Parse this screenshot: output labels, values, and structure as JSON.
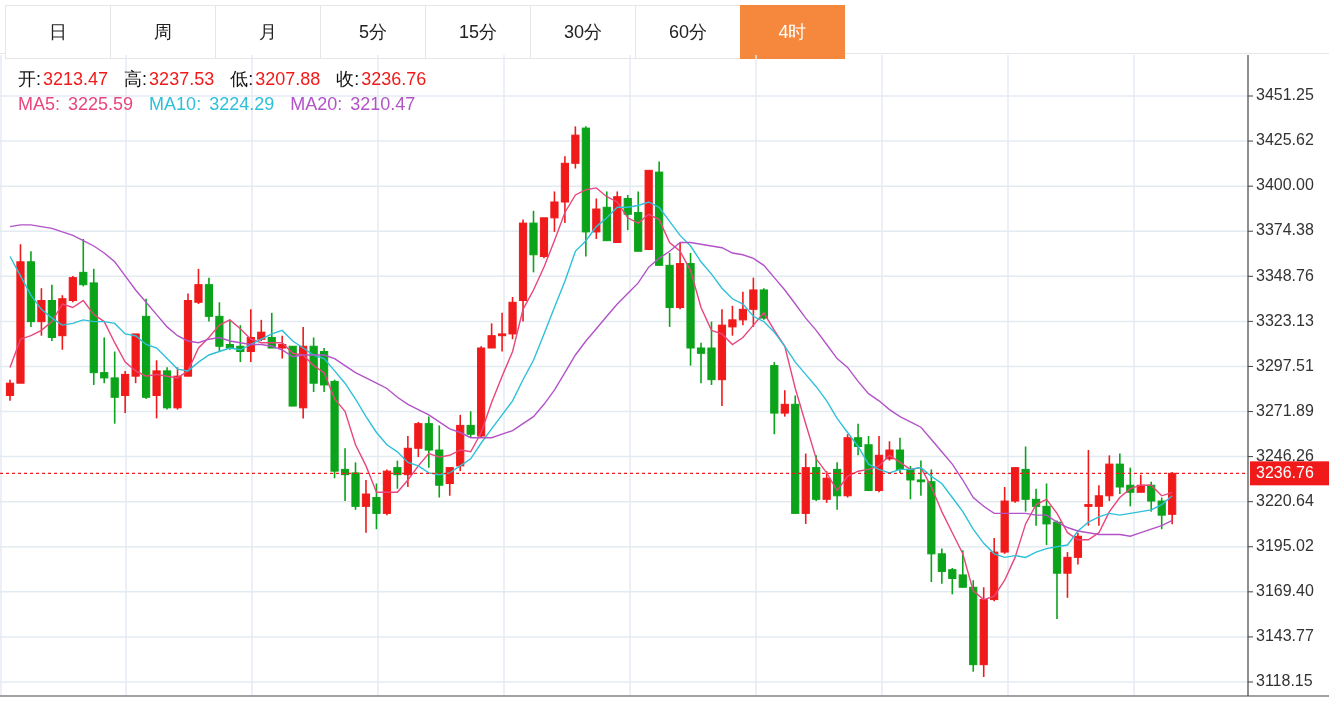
{
  "tabs": [
    {
      "label": "日",
      "selected": false
    },
    {
      "label": "周",
      "selected": false
    },
    {
      "label": "月",
      "selected": false
    },
    {
      "label": "5分",
      "selected": false
    },
    {
      "label": "15分",
      "selected": false
    },
    {
      "label": "30分",
      "selected": false
    },
    {
      "label": "60分",
      "selected": false
    },
    {
      "label": "4时",
      "selected": true
    }
  ],
  "ohlc_legend": [
    {
      "label": "开:",
      "value": "3213.47"
    },
    {
      "label": "高:",
      "value": "3237.53"
    },
    {
      "label": "低:",
      "value": "3207.88"
    },
    {
      "label": "收:",
      "value": "3236.76"
    }
  ],
  "ma_legend": [
    {
      "separator": ":",
      "value": "3225.59"
    },
    {
      "separator": ":",
      "value": "3224.29"
    },
    {
      "separator": ":",
      "value": "3210.47"
    }
  ],
  "chart_data": {
    "type": "candlestick",
    "grid": true,
    "ylim": [
      3118.15,
      3451.25
    ],
    "yticks": [
      {
        "value": 3451.25,
        "label": "3451.25"
      },
      {
        "value": 3425.62,
        "label": "3425.62"
      },
      {
        "value": 3400,
        "label": "3400.00"
      },
      {
        "value": 3374.38,
        "label": "3374.38"
      },
      {
        "value": 3348.76,
        "label": "3348.76"
      },
      {
        "value": 3323.13,
        "label": "3323.13"
      },
      {
        "value": 3297.51,
        "label": "3297.51"
      },
      {
        "value": 3271.89,
        "label": "3271.89"
      },
      {
        "value": 3246.26,
        "label": "3246.26"
      },
      {
        "value": 3220.64,
        "label": "3220.64"
      },
      {
        "value": 3195.02,
        "label": "3195.02"
      },
      {
        "value": 3169.4,
        "label": "3169.40"
      },
      {
        "value": 3143.77,
        "label": "3143.77"
      },
      {
        "value": 3118.15,
        "label": "3118.15"
      }
    ],
    "ref_lines": [
      {
        "axis": "y",
        "value": 3236.76,
        "label": "3236.76",
        "color": "#f01a1a"
      }
    ],
    "series": [
      {
        "name": "MA5",
        "type": "line",
        "color": "#e8467c",
        "values": [
          3297,
          3313,
          3315,
          3318,
          3323,
          3333,
          3331,
          3335,
          3327,
          3323,
          3311,
          3300,
          3295,
          3292,
          3293,
          3292,
          3291,
          3295,
          3308,
          3314,
          3321,
          3324,
          3319,
          3313,
          3311,
          3311,
          3311,
          3305,
          3304,
          3298,
          3294,
          3279,
          3272,
          3253,
          3241,
          3226,
          3226,
          3226,
          3233,
          3241,
          3248,
          3246,
          3247,
          3250,
          3249,
          3260,
          3277,
          3292,
          3306,
          3330,
          3341,
          3354,
          3369,
          3385,
          3395,
          3398,
          3399,
          3394,
          3391,
          3382,
          3379,
          3384,
          3381,
          3368,
          3363,
          3352,
          3331,
          3318,
          3316,
          3310,
          3314,
          3321,
          3328,
          3318,
          3309,
          3285,
          3265,
          3245,
          3237,
          3227,
          3235,
          3238,
          3239,
          3241,
          3247,
          3243,
          3239,
          3240,
          3229,
          3215,
          3203,
          3191,
          3170,
          3165,
          3167,
          3176,
          3189,
          3208,
          3219,
          3222,
          3214,
          3203,
          3199,
          3199,
          3203,
          3215,
          3223,
          3228,
          3230,
          3230,
          3224,
          3226
        ]
      },
      {
        "name": "MA10",
        "type": "line",
        "color": "#2ec0d9",
        "values": [
          3360,
          3349,
          3338,
          3330,
          3325,
          3321,
          3322,
          3324,
          3323,
          3323,
          3322,
          3316,
          3315,
          3310,
          3308,
          3302,
          3296,
          3295,
          3300,
          3304,
          3306,
          3308,
          3307,
          3310,
          3313,
          3316,
          3318,
          3312,
          3308,
          3304,
          3302,
          3295,
          3288,
          3279,
          3269,
          3260,
          3253,
          3249,
          3243,
          3241,
          3237,
          3236,
          3237,
          3241,
          3245,
          3254,
          3262,
          3270,
          3278,
          3290,
          3301,
          3316,
          3331,
          3346,
          3363,
          3369,
          3377,
          3382,
          3388,
          3388,
          3389,
          3391,
          3388,
          3380,
          3372,
          3366,
          3357,
          3350,
          3342,
          3336,
          3333,
          3326,
          3323,
          3317,
          3309,
          3300,
          3293,
          3286,
          3278,
          3268,
          3260,
          3252,
          3242,
          3239,
          3237,
          3239,
          3239,
          3240,
          3235,
          3231,
          3223,
          3215,
          3205,
          3197,
          3191,
          3189,
          3190,
          3189,
          3192,
          3194,
          3195,
          3196,
          3204,
          3209,
          3212,
          3214,
          3213,
          3214,
          3215,
          3216,
          3219,
          3224
        ]
      },
      {
        "name": "MA20",
        "type": "line",
        "color": "#b253c8",
        "values": [
          3377,
          3378,
          3378,
          3377,
          3376,
          3374,
          3372,
          3369,
          3366,
          3362,
          3357,
          3349,
          3341,
          3334,
          3327,
          3320,
          3315,
          3312,
          3311,
          3313,
          3314,
          3312,
          3311,
          3310,
          3310,
          3309,
          3307,
          3303,
          3304,
          3304,
          3304,
          3302,
          3298,
          3294,
          3291,
          3288,
          3285,
          3280,
          3276,
          3273,
          3270,
          3266,
          3262,
          3260,
          3257,
          3257,
          3257,
          3259,
          3261,
          3265,
          3269,
          3276,
          3284,
          3294,
          3304,
          3312,
          3319,
          3326,
          3333,
          3339,
          3345,
          3354,
          3359,
          3363,
          3368,
          3368,
          3367,
          3366,
          3365,
          3362,
          3361,
          3359,
          3355,
          3348,
          3341,
          3333,
          3325,
          3318,
          3310,
          3302,
          3297,
          3289,
          3282,
          3278,
          3273,
          3269,
          3266,
          3263,
          3256,
          3249,
          3242,
          3233,
          3223,
          3218,
          3214,
          3214,
          3214,
          3214,
          3213,
          3213,
          3209,
          3206,
          3204,
          3203,
          3202,
          3202,
          3202,
          3201,
          3203,
          3205,
          3207,
          3210
        ]
      }
    ],
    "ohlc": [
      [
        3281,
        3290,
        3278,
        3288
      ],
      [
        3288,
        3367,
        3288,
        3357
      ],
      [
        3357,
        3363,
        3320,
        3323
      ],
      [
        3323,
        3342,
        3315,
        3335
      ],
      [
        3335,
        3344,
        3312,
        3314
      ],
      [
        3315,
        3338,
        3307,
        3336
      ],
      [
        3335,
        3349,
        3334,
        3348
      ],
      [
        3351,
        3370,
        3343,
        3344
      ],
      [
        3345,
        3353,
        3287,
        3294
      ],
      [
        3294,
        3314,
        3288,
        3291
      ],
      [
        3291,
        3306,
        3265,
        3280
      ],
      [
        3281,
        3295,
        3271,
        3293
      ],
      [
        3292,
        3316,
        3288,
        3316
      ],
      [
        3326,
        3336,
        3279,
        3280
      ],
      [
        3281,
        3301,
        3268,
        3295
      ],
      [
        3295,
        3297,
        3273,
        3274
      ],
      [
        3274,
        3297,
        3273,
        3292
      ],
      [
        3292,
        3339,
        3292,
        3335
      ],
      [
        3334,
        3353,
        3333,
        3344
      ],
      [
        3344,
        3348,
        3323,
        3326
      ],
      [
        3326,
        3334,
        3306,
        3309
      ],
      [
        3310,
        3324,
        3307,
        3308
      ],
      [
        3309,
        3321,
        3300,
        3306
      ],
      [
        3306,
        3330,
        3300,
        3314
      ],
      [
        3313,
        3324,
        3312,
        3317
      ],
      [
        3314,
        3328,
        3308,
        3308
      ],
      [
        3308,
        3315,
        3302,
        3310
      ],
      [
        3309,
        3309,
        3275,
        3275
      ],
      [
        3274,
        3320,
        3268,
        3309
      ],
      [
        3309,
        3314,
        3283,
        3288
      ],
      [
        3306,
        3308,
        3283,
        3287
      ],
      [
        3289,
        3290,
        3234,
        3238
      ],
      [
        3239,
        3251,
        3221,
        3236
      ],
      [
        3237,
        3243,
        3216,
        3218
      ],
      [
        3218,
        3233,
        3203,
        3225
      ],
      [
        3223,
        3231,
        3205,
        3214
      ],
      [
        3214,
        3239,
        3213,
        3238
      ],
      [
        3240,
        3244,
        3228,
        3236
      ],
      [
        3236,
        3258,
        3229,
        3251
      ],
      [
        3251,
        3266,
        3246,
        3265
      ],
      [
        3265,
        3269,
        3240,
        3250
      ],
      [
        3250,
        3264,
        3223,
        3230
      ],
      [
        3231,
        3240,
        3224,
        3240
      ],
      [
        3241,
        3270,
        3238,
        3264
      ],
      [
        3264,
        3272,
        3257,
        3259
      ],
      [
        3258,
        3309,
        3257,
        3308
      ],
      [
        3308,
        3322,
        3308,
        3315
      ],
      [
        3315,
        3328,
        3306,
        3316
      ],
      [
        3316,
        3337,
        3313,
        3334
      ],
      [
        3335,
        3381,
        3323,
        3379
      ],
      [
        3379,
        3386,
        3351,
        3361
      ],
      [
        3360,
        3382,
        3359,
        3382
      ],
      [
        3382,
        3397,
        3374,
        3391
      ],
      [
        3391,
        3417,
        3379,
        3413
      ],
      [
        3413,
        3434,
        3410,
        3429
      ],
      [
        3433,
        3434,
        3360,
        3374
      ],
      [
        3374,
        3393,
        3370,
        3387
      ],
      [
        3388,
        3397,
        3369,
        3369
      ],
      [
        3368,
        3397,
        3368,
        3394
      ],
      [
        3393,
        3395,
        3375,
        3384
      ],
      [
        3385,
        3397,
        3363,
        3363
      ],
      [
        3364,
        3409,
        3364,
        3409
      ],
      [
        3408,
        3414,
        3355,
        3355
      ],
      [
        3355,
        3362,
        3320,
        3331
      ],
      [
        3331,
        3368,
        3330,
        3356
      ],
      [
        3356,
        3362,
        3298,
        3308
      ],
      [
        3308,
        3311,
        3288,
        3305
      ],
      [
        3308,
        3323,
        3287,
        3290
      ],
      [
        3290,
        3330,
        3275,
        3321
      ],
      [
        3320,
        3332,
        3315,
        3324
      ],
      [
        3324,
        3340,
        3321,
        3330
      ],
      [
        3330,
        3348,
        3320,
        3341
      ],
      [
        3341,
        3342,
        3324,
        3325
      ],
      [
        3298,
        3300,
        3259,
        3271
      ],
      [
        3271,
        3284,
        3269,
        3276
      ],
      [
        3276,
        3281,
        3214,
        3214
      ],
      [
        3214,
        3248,
        3208,
        3240
      ],
      [
        3240,
        3247,
        3221,
        3222
      ],
      [
        3222,
        3238,
        3220,
        3234
      ],
      [
        3239,
        3243,
        3216,
        3224
      ],
      [
        3224,
        3259,
        3223,
        3257
      ],
      [
        3257,
        3265,
        3247,
        3252
      ],
      [
        3253,
        3258,
        3227,
        3227
      ],
      [
        3227,
        3258,
        3226,
        3247
      ],
      [
        3245,
        3255,
        3244,
        3250
      ],
      [
        3250,
        3257,
        3237,
        3239
      ],
      [
        3239,
        3241,
        3222,
        3233
      ],
      [
        3233,
        3244,
        3224,
        3232
      ],
      [
        3232,
        3239,
        3175,
        3191
      ],
      [
        3191,
        3194,
        3174,
        3181
      ],
      [
        3182,
        3183,
        3168,
        3177
      ],
      [
        3179,
        3193,
        3172,
        3172
      ],
      [
        3172,
        3176,
        3124,
        3128
      ],
      [
        3128,
        3172,
        3121,
        3165
      ],
      [
        3165,
        3200,
        3164,
        3192
      ],
      [
        3192,
        3229,
        3191,
        3221
      ],
      [
        3221,
        3240,
        3220,
        3240
      ],
      [
        3239,
        3252,
        3215,
        3222
      ],
      [
        3222,
        3228,
        3207,
        3218
      ],
      [
        3218,
        3231,
        3196,
        3208
      ],
      [
        3209,
        3210,
        3154,
        3180
      ],
      [
        3180,
        3192,
        3166,
        3189
      ],
      [
        3189,
        3203,
        3185,
        3201
      ],
      [
        3218,
        3250,
        3207,
        3219
      ],
      [
        3218,
        3230,
        3207,
        3224
      ],
      [
        3224,
        3247,
        3221,
        3242
      ],
      [
        3242,
        3248,
        3225,
        3229
      ],
      [
        3230,
        3240,
        3218,
        3226
      ],
      [
        3226,
        3236,
        3226,
        3230
      ],
      [
        3230,
        3232,
        3215,
        3221
      ],
      [
        3221,
        3223,
        3205,
        3213
      ],
      [
        3213.47,
        3237.53,
        3207.88,
        3236.76
      ]
    ]
  }
}
